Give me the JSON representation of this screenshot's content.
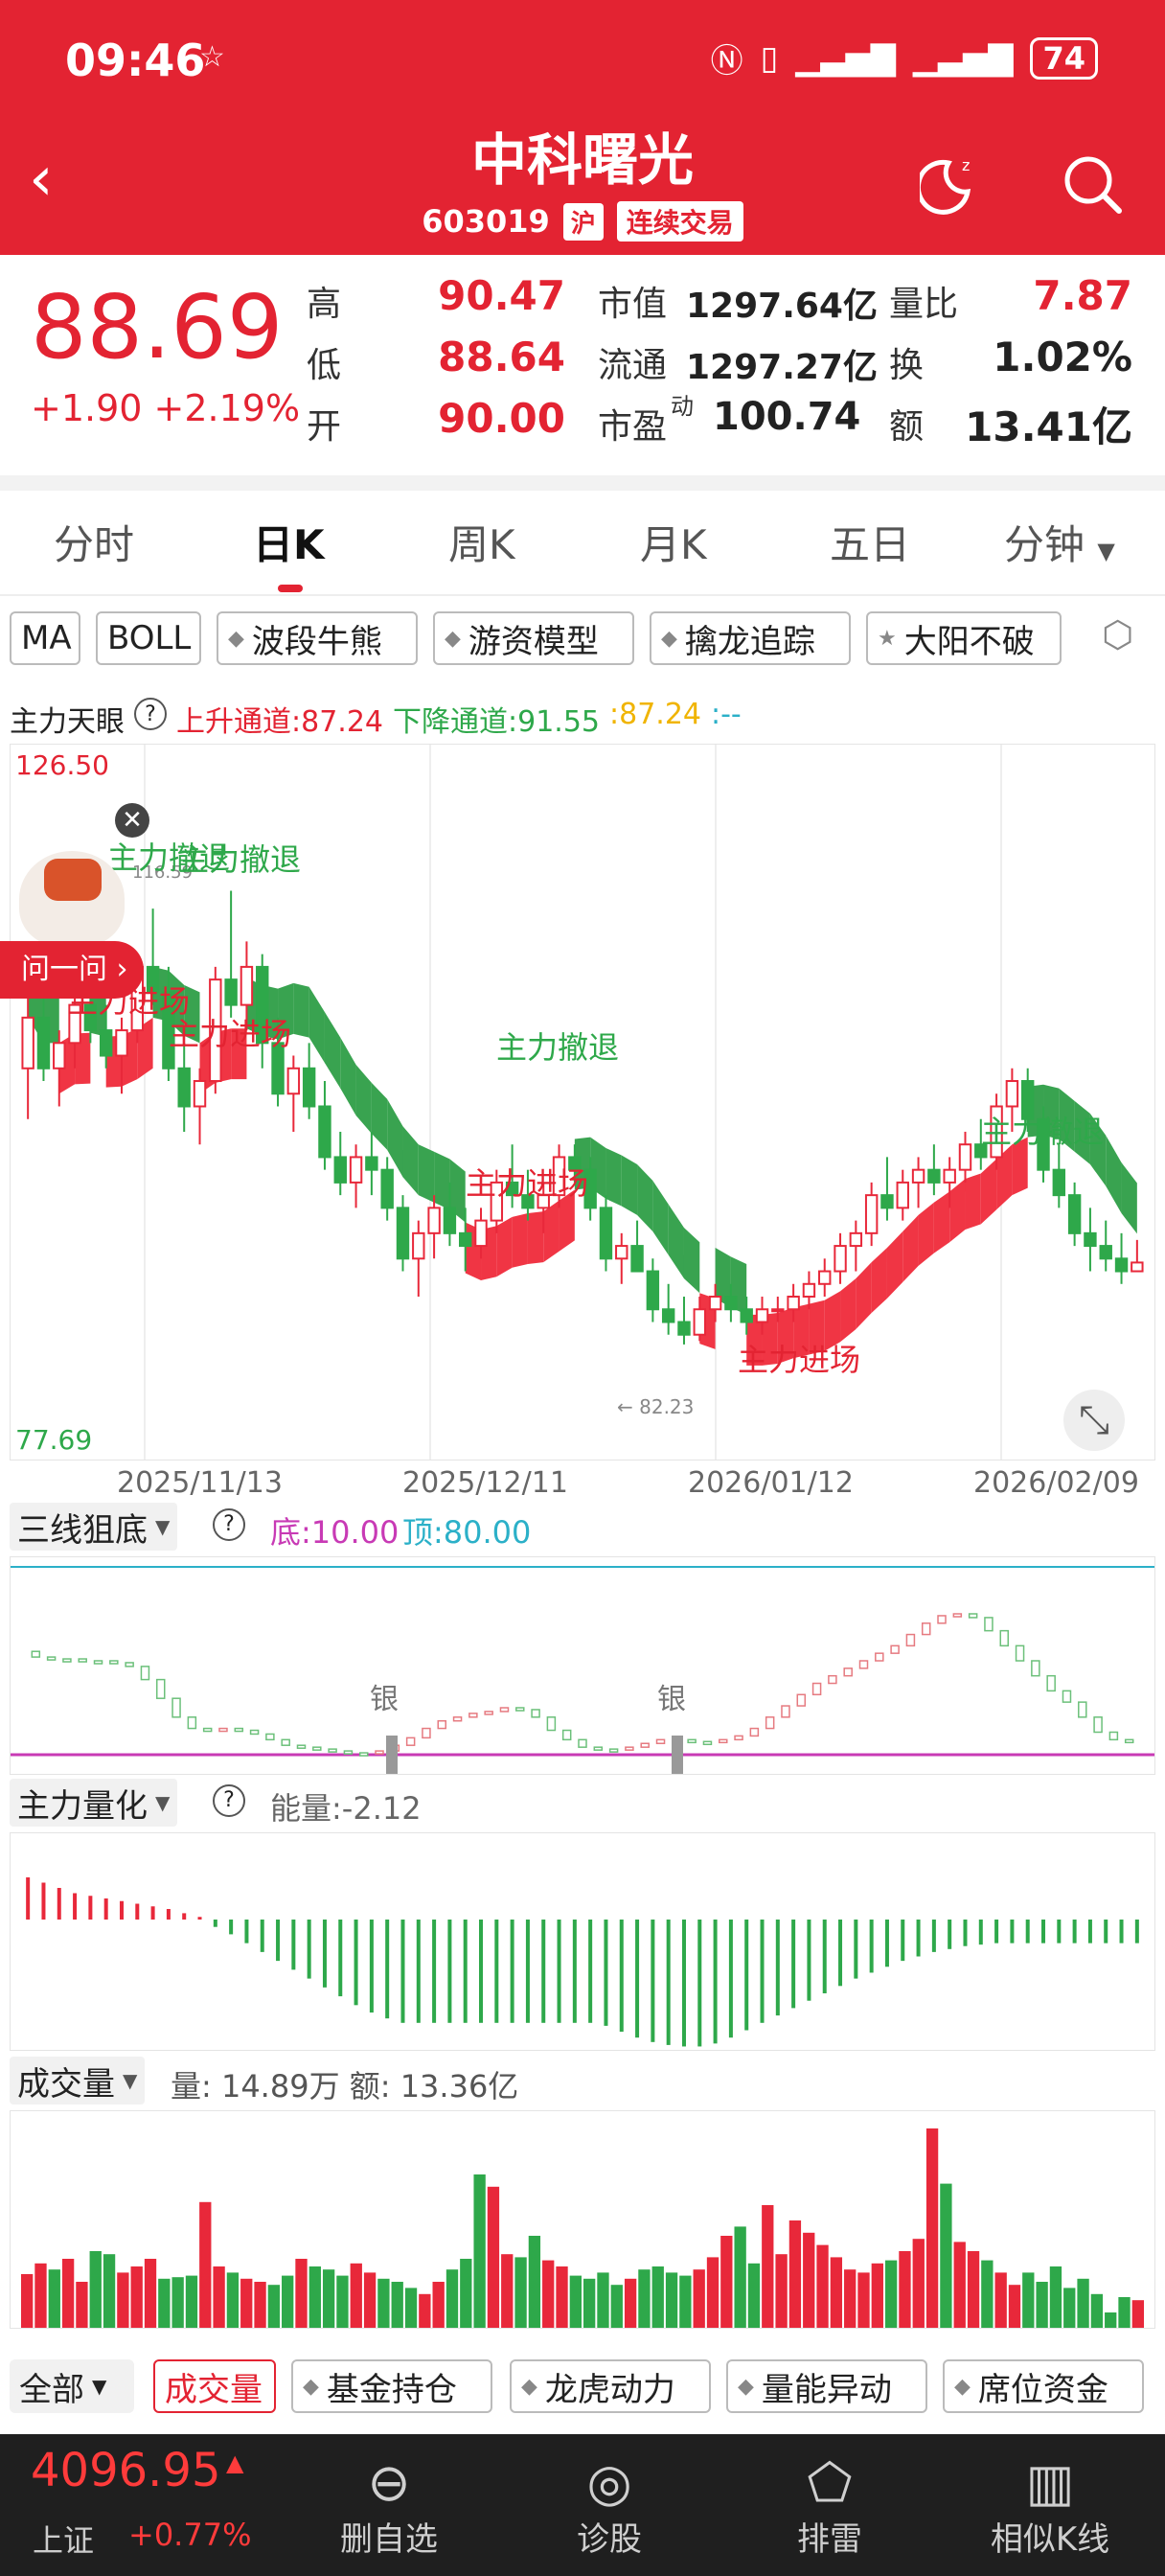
{
  "status": {
    "time": "09:46",
    "battery": "74"
  },
  "header": {
    "title": "中科曙光",
    "code": "603019",
    "market_tag": "沪",
    "trade_tag": "连续交易"
  },
  "quote": {
    "price": "88.69",
    "change": "+1.90 +2.19%",
    "high_label": "高",
    "high": "90.47",
    "low_label": "低",
    "low": "88.64",
    "open_label": "开",
    "open": "90.00",
    "mcap_label": "市值",
    "mcap": "1297.64亿",
    "float_label": "流通",
    "float": "1297.27亿",
    "pe_label": "市盈",
    "pe_sup": "动",
    "pe": "100.74",
    "vr_label": "量比",
    "vr": "7.87",
    "turn_label": "换",
    "turn": "1.02%",
    "amt_label": "额",
    "amt": "13.41亿"
  },
  "tabs": [
    "分时",
    "日K",
    "周K",
    "月K",
    "五日",
    "分钟"
  ],
  "chips": [
    "MA",
    "BOLL",
    "波段牛熊",
    "游资模型",
    "擒龙追踪",
    "大阳不破"
  ],
  "main_chart": {
    "indicator": "主力天眼",
    "up_channel": "上升通道:87.24",
    "down_channel": "下降通道:91.55",
    "extra1": ":87.24",
    "extra2": ":--",
    "y_max": "126.50",
    "y_min": "77.69",
    "high_mark": "116.59",
    "low_mark": "← 82.23",
    "x_labels": [
      "2025/11/13",
      "2025/12/11",
      "2026/01/12",
      "2026/02/09"
    ],
    "signals": [
      "主力撤退",
      "主力撤退",
      "主力进场",
      "主力进场",
      "主力撤退",
      "主力进场",
      "主力进场",
      "主力撤退"
    ],
    "ask_button": "问一问 ›",
    "colors": {
      "up": "#e8283a",
      "down": "#2ea84a",
      "band_green": "#2e9e47",
      "band_red": "#ef2a3a"
    }
  },
  "chart_data": {
    "type": "candlestick",
    "y_range": [
      77.69,
      126.5
    ],
    "dates_shown": [
      "2025/11/13",
      "2025/12/11",
      "2026/01/12",
      "2026/02/09"
    ],
    "candles": [
      [
        104,
        110,
        100,
        108
      ],
      [
        108,
        111,
        103,
        104
      ],
      [
        104,
        107,
        101,
        106
      ],
      [
        106,
        110,
        104,
        109
      ],
      [
        109,
        112,
        106,
        107
      ],
      [
        107,
        109,
        104,
        105
      ],
      [
        105,
        108,
        102,
        107
      ],
      [
        107,
        113,
        106,
        112
      ],
      [
        112,
        116.59,
        109,
        110
      ],
      [
        110,
        112,
        103,
        104
      ],
      [
        104,
        106,
        99,
        101
      ],
      [
        101,
        104,
        98,
        103
      ],
      [
        103,
        112,
        102,
        111
      ],
      [
        111,
        118,
        108,
        109
      ],
      [
        109,
        114,
        107,
        112
      ],
      [
        112,
        113,
        104,
        106
      ],
      [
        106,
        108,
        101,
        102
      ],
      [
        102,
        105,
        99,
        104
      ],
      [
        104,
        106,
        100,
        101
      ],
      [
        101,
        103,
        96,
        97
      ],
      [
        97,
        99,
        94,
        95
      ],
      [
        95,
        98,
        93,
        97
      ],
      [
        97,
        99,
        94,
        96
      ],
      [
        96,
        97,
        92,
        93
      ],
      [
        93,
        94,
        88,
        89
      ],
      [
        89,
        92,
        86,
        91
      ],
      [
        91,
        94,
        89,
        93
      ],
      [
        93,
        95,
        90,
        91
      ],
      [
        91,
        93,
        88,
        90
      ],
      [
        90,
        93,
        89,
        92
      ],
      [
        92,
        96,
        91,
        95
      ],
      [
        95,
        98,
        93,
        94
      ],
      [
        94,
        96,
        92,
        93
      ],
      [
        93,
        95,
        91,
        94
      ],
      [
        94,
        98,
        93,
        97
      ],
      [
        97,
        98,
        95,
        96
      ],
      [
        96,
        97,
        92,
        93
      ],
      [
        93,
        94,
        88,
        89
      ],
      [
        89,
        91,
        87,
        90
      ],
      [
        90,
        92,
        88,
        88
      ],
      [
        88,
        89,
        84,
        85
      ],
      [
        85,
        87,
        83,
        84
      ],
      [
        84,
        86,
        82.23,
        83
      ],
      [
        83,
        86,
        82.5,
        85
      ],
      [
        85,
        87,
        84,
        86
      ],
      [
        86,
        87,
        84,
        85
      ],
      [
        85,
        86,
        83,
        84
      ],
      [
        84,
        86,
        83,
        85
      ],
      [
        85,
        86,
        84,
        85
      ],
      [
        85,
        87,
        84,
        86
      ],
      [
        86,
        88,
        85,
        87
      ],
      [
        87,
        89,
        86,
        88
      ],
      [
        88,
        91,
        87,
        90
      ],
      [
        90,
        92,
        88,
        91
      ],
      [
        91,
        95,
        90,
        94
      ],
      [
        94,
        97,
        92,
        93
      ],
      [
        93,
        96,
        92,
        95
      ],
      [
        95,
        97,
        93,
        96
      ],
      [
        96,
        98,
        94,
        95
      ],
      [
        95,
        97,
        93,
        96
      ],
      [
        96,
        99,
        95,
        98
      ],
      [
        98,
        100,
        96,
        97
      ],
      [
        97,
        102,
        96,
        101
      ],
      [
        101,
        104,
        99,
        103
      ],
      [
        103,
        104,
        99,
        100
      ],
      [
        100,
        101,
        95,
        96
      ],
      [
        96,
        98,
        93,
        94
      ],
      [
        94,
        95,
        90,
        91
      ],
      [
        91,
        93,
        88,
        90
      ],
      [
        90,
        92,
        88,
        89
      ],
      [
        89,
        91,
        87,
        88
      ],
      [
        88,
        90.47,
        88.64,
        88.69
      ]
    ],
    "indicator_sanxian": {
      "name": "三线狙底",
      "bottom_label": "底:10.00",
      "top_label": "顶:80.00",
      "bottom": 10,
      "top": 80,
      "marks": [
        "银",
        "银"
      ],
      "values": [
        55,
        52,
        51,
        51,
        50,
        50,
        49,
        47,
        40,
        30,
        20,
        14,
        13,
        14,
        13,
        11,
        8,
        5,
        4,
        3,
        2,
        1,
        1,
        2,
        5,
        9,
        14,
        18,
        20,
        22,
        23,
        25,
        24,
        20,
        13,
        8,
        4,
        3,
        3,
        4,
        6,
        8,
        8,
        7,
        7,
        8,
        10,
        14,
        20,
        26,
        32,
        38,
        42,
        46,
        50,
        54,
        58,
        64,
        70,
        74,
        75,
        73,
        66,
        58,
        50,
        42,
        34,
        28,
        20,
        12,
        8,
        7
      ]
    },
    "indicator_zhuli": {
      "name": "主力量化",
      "label": "能量:-2.12",
      "values": [
        8,
        7,
        6,
        5,
        4.5,
        4,
        3.5,
        3,
        2.5,
        2,
        1.2,
        0.5,
        -0.5,
        -1,
        -1.6,
        -2.2,
        -2.8,
        -3.4,
        -4,
        -4.6,
        -5.2,
        -5.8,
        -6.3,
        -6.7,
        -7,
        -7,
        -7,
        -7,
        -7,
        -7,
        -7,
        -7,
        -7,
        -7,
        -7,
        -7,
        -7,
        -7.2,
        -7.6,
        -8,
        -8.3,
        -8.5,
        -8.6,
        -8.6,
        -8.4,
        -8,
        -7.5,
        -7,
        -6.5,
        -6,
        -5.5,
        -5,
        -4.5,
        -4,
        -3.6,
        -3.2,
        -2.8,
        -2.5,
        -2.2,
        -2,
        -1.8,
        -1.7,
        -1.6,
        -1.6,
        -1.6,
        -1.6,
        -1.6,
        -1.6,
        -1.6,
        -1.6,
        -1.6,
        -1.6
      ]
    },
    "volume": {
      "name": "成交量",
      "label": "量: 14.89万 额: 13.36亿",
      "values": [
        35,
        42,
        38,
        45,
        30,
        50,
        48,
        36,
        40,
        45,
        32,
        33,
        34,
        82,
        40,
        36,
        32,
        30,
        28,
        34,
        45,
        40,
        38,
        34,
        42,
        36,
        32,
        30,
        26,
        22,
        30,
        38,
        45,
        100,
        92,
        48,
        46,
        60,
        44,
        40,
        34,
        32,
        36,
        28,
        32,
        38,
        40,
        36,
        34,
        38,
        46,
        60,
        66,
        42,
        80,
        48,
        70,
        62,
        54,
        46,
        38,
        36,
        42,
        44,
        50,
        58,
        130,
        94,
        56,
        50,
        44,
        36,
        28,
        36,
        30,
        40,
        26,
        32,
        22,
        10,
        20,
        18
      ]
    }
  },
  "bottom_tabs": [
    "全部",
    "成交量",
    "基金持仓",
    "龙虎动力",
    "量能异动",
    "席位资金"
  ],
  "bottom_nav": {
    "index_value": "4096.95",
    "index_name": "上证",
    "index_change": "+0.77%",
    "items": [
      {
        "label": "删自选",
        "icon": "minus-circle-icon"
      },
      {
        "label": "诊股",
        "icon": "diagnose-icon"
      },
      {
        "label": "排雷",
        "icon": "mine-icon"
      },
      {
        "label": "相似K线",
        "icon": "bar-chart-icon"
      }
    ]
  }
}
